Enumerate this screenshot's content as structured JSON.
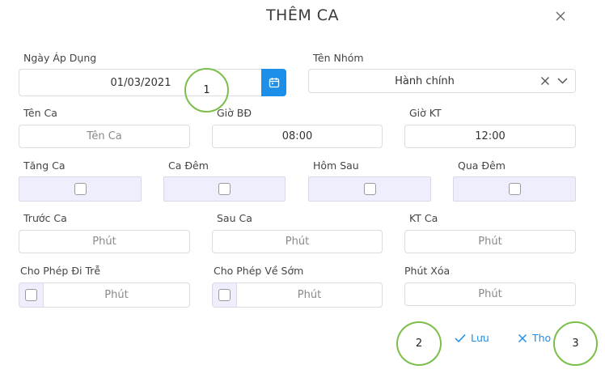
{
  "dialog": {
    "title": "THÊM CA"
  },
  "form": {
    "ngay_ap_dung": {
      "label": "Ngày Áp Dụng",
      "value": "01/03/2021"
    },
    "ten_nhom": {
      "label": "Tên Nhóm",
      "value": "Hành chính"
    },
    "ten_ca": {
      "label": "Tên Ca",
      "placeholder": "Tên Ca"
    },
    "gio_bd": {
      "label": "Giờ BĐ",
      "value": "08:00"
    },
    "gio_kt": {
      "label": "Giờ KT",
      "value": "12:00"
    },
    "tang_ca": {
      "label": "Tăng Ca",
      "checked": false
    },
    "ca_dem": {
      "label": "Ca Đêm",
      "checked": false
    },
    "hom_sau": {
      "label": "Hôm Sau",
      "checked": false
    },
    "qua_dem": {
      "label": "Qua Đêm",
      "checked": false
    },
    "truoc_ca": {
      "label": "Trước Ca",
      "placeholder": "Phút"
    },
    "sau_ca": {
      "label": "Sau Ca",
      "placeholder": "Phút"
    },
    "kt_ca": {
      "label": "KT Ca",
      "placeholder": "Phút"
    },
    "cho_phep_di_tre": {
      "label": "Cho Phép Đi Trễ",
      "placeholder": "Phút",
      "checked": false
    },
    "cho_phep_ve_som": {
      "label": "Cho Phép Về Sớm",
      "placeholder": "Phút",
      "checked": false
    },
    "phut_xoa": {
      "label": "Phút Xóa",
      "placeholder": "Phút"
    }
  },
  "actions": {
    "save_label": "Lưu",
    "exit_label": "Tho"
  },
  "annotations": {
    "one": "1",
    "two": "2",
    "three": "3"
  },
  "colors": {
    "accent": "#1e8fe8",
    "checkbox_cell": "#eeeefc",
    "annotation_circle": "#7bbf4a"
  }
}
